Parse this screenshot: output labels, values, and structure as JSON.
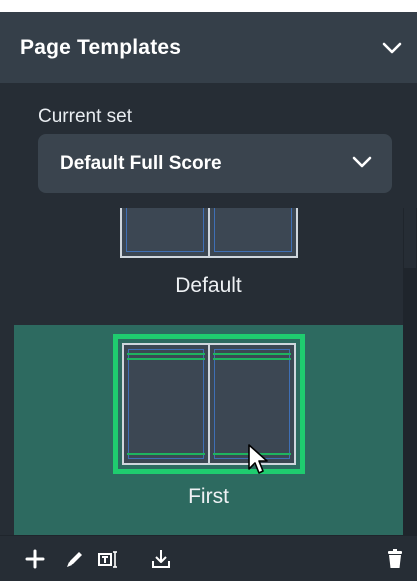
{
  "header": {
    "title": "Page Templates"
  },
  "current_set": {
    "label": "Current set",
    "value": "Default Full Score"
  },
  "templates": [
    {
      "label": "Default",
      "selected": false
    },
    {
      "label": "First",
      "selected": true
    }
  ],
  "toolbar": {
    "icons": [
      "add-icon",
      "edit-icon",
      "rename-icon",
      "import-icon",
      "delete-icon"
    ]
  },
  "colors": {
    "header_bg": "#353f49",
    "panel_bg": "#262d35",
    "dropdown_bg": "#3a444e",
    "selected_bg": "#2d6a60",
    "selection_border": "#1fcc6f",
    "margin_line": "#3f6fb5"
  }
}
